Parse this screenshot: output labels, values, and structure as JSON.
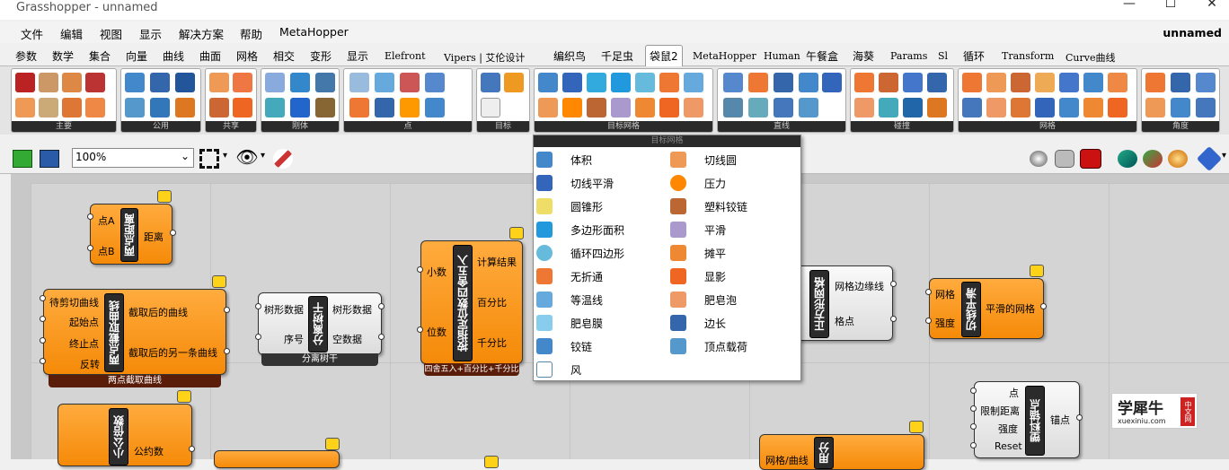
{
  "window": {
    "title": "Grasshopper - unnamed",
    "minimize": "—",
    "maximize": "☐",
    "close": "✕"
  },
  "menu": {
    "items": [
      "文件",
      "编辑",
      "视图",
      "显示",
      "解决方案",
      "帮助",
      "MetaHopper"
    ],
    "document": "unnamed"
  },
  "tabs": [
    "参数",
    "数学",
    "集合",
    "向量",
    "曲线",
    "曲面",
    "网格",
    "相交",
    "变形",
    "显示",
    "Elefront",
    "Vipers | 艾伦设计",
    "编织鸟",
    "千足虫",
    "袋鼠2",
    "MetaHopper",
    "Human",
    "午餐盒",
    "海葵",
    "Params",
    "Sl",
    "循环",
    "Transform",
    "Curve曲线"
  ],
  "active_tab": "袋鼠2",
  "ribbon_groups": [
    "主要",
    "公用",
    "共享",
    "刚体",
    "点",
    "目标",
    "目标网格",
    "直线",
    "碰撞",
    "网格",
    "角度"
  ],
  "dropdown_header": "目标网格",
  "zoom": "100%",
  "dropdown_items_left": [
    "体积",
    "切线平滑",
    "圆锥形",
    "多边形面积",
    "循环四边形",
    "无折通",
    "等温线",
    "肥皂膜",
    "铰链",
    "风"
  ],
  "dropdown_items_right": [
    "切线圆",
    "压力",
    "塑料铰链",
    "平滑",
    "摊平",
    "显影",
    "肥皂泡",
    "边长",
    "顶点载荷"
  ],
  "components": {
    "c1": {
      "title": "两点距离",
      "inputs": [
        "点A",
        "点B"
      ],
      "outputs": [
        "距离"
      ]
    },
    "c2": {
      "title": "两点截取曲线",
      "inputs": [
        "待剪切曲线",
        "起始点",
        "终止点",
        "反转"
      ],
      "outputs": [
        "截取后的曲线",
        "截取后的另一条曲线"
      ],
      "caption": "两点截取曲线"
    },
    "c3": {
      "title": "分离树干",
      "inputs": [
        "树形数据",
        "序号"
      ],
      "outputs": [
        "树形数据",
        "空数据"
      ],
      "caption": "分离树干"
    },
    "c4": {
      "title": "按指定位数四舍五入",
      "inputs": [
        "小数",
        "位数"
      ],
      "outputs": [
        "计算结果",
        "百分比",
        "千分比"
      ],
      "caption": "四舍五入+百分比+千分比"
    },
    "c5": {
      "title": "正方形网格",
      "inputs": [],
      "outputs": [
        "网格边缘线",
        "格点"
      ]
    },
    "c6": {
      "title": "切线平滑",
      "inputs": [
        "网格",
        "强度"
      ],
      "outputs": [
        "平滑的网格"
      ]
    },
    "c7": {
      "title": "塑料锚点",
      "inputs": [
        "点",
        "限制距离",
        "强度",
        "Reset"
      ],
      "outputs": [
        "锚点"
      ]
    },
    "c8": {
      "title": "小公倍数",
      "inputs": [],
      "outputs": [
        "公约数"
      ]
    },
    "c9": {
      "title": "用分",
      "inputs": [
        "网格/曲线"
      ],
      "outputs": []
    }
  },
  "watermark": {
    "main": "学犀牛",
    "badge": "中文网",
    "url": "xuexiniu.com"
  }
}
